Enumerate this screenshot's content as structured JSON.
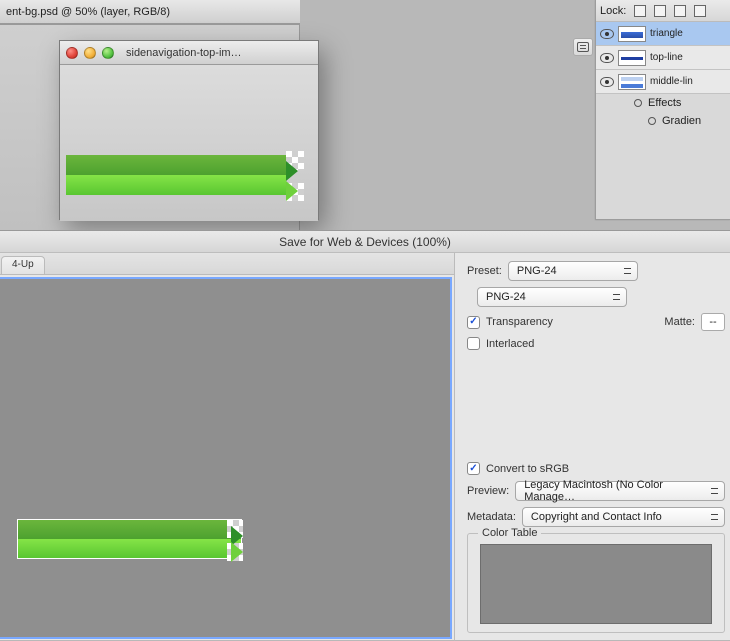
{
  "bg_doc": {
    "title": "ent-bg.psd @ 50% (layer, RGB/8)"
  },
  "front_doc": {
    "title": "sidenavigation-top-im…"
  },
  "layers_panel": {
    "lock_label": "Lock:",
    "layers": [
      {
        "name": "triangle",
        "selected": true
      },
      {
        "name": "top-line",
        "selected": false
      },
      {
        "name": "middle-lin",
        "selected": false
      }
    ],
    "effects_label": "Effects",
    "effect_item": "Gradien"
  },
  "sfw": {
    "title": "Save for Web & Devices (100%)",
    "tab_label": "4-Up",
    "preset_label": "Preset:",
    "preset_value": "PNG-24",
    "format_value": "PNG-24",
    "transparency_label": "Transparency",
    "matte_label": "Matte:",
    "matte_value": "--",
    "interlaced_label": "Interlaced",
    "convert_label": "Convert to sRGB",
    "preview_label": "Preview:",
    "preview_value": "Legacy Macintosh (No Color Manage…",
    "metadata_label": "Metadata:",
    "metadata_value": "Copyright and Contact Info",
    "colortable_label": "Color Table",
    "transparency_checked": true,
    "interlaced_checked": false,
    "convert_checked": true
  }
}
